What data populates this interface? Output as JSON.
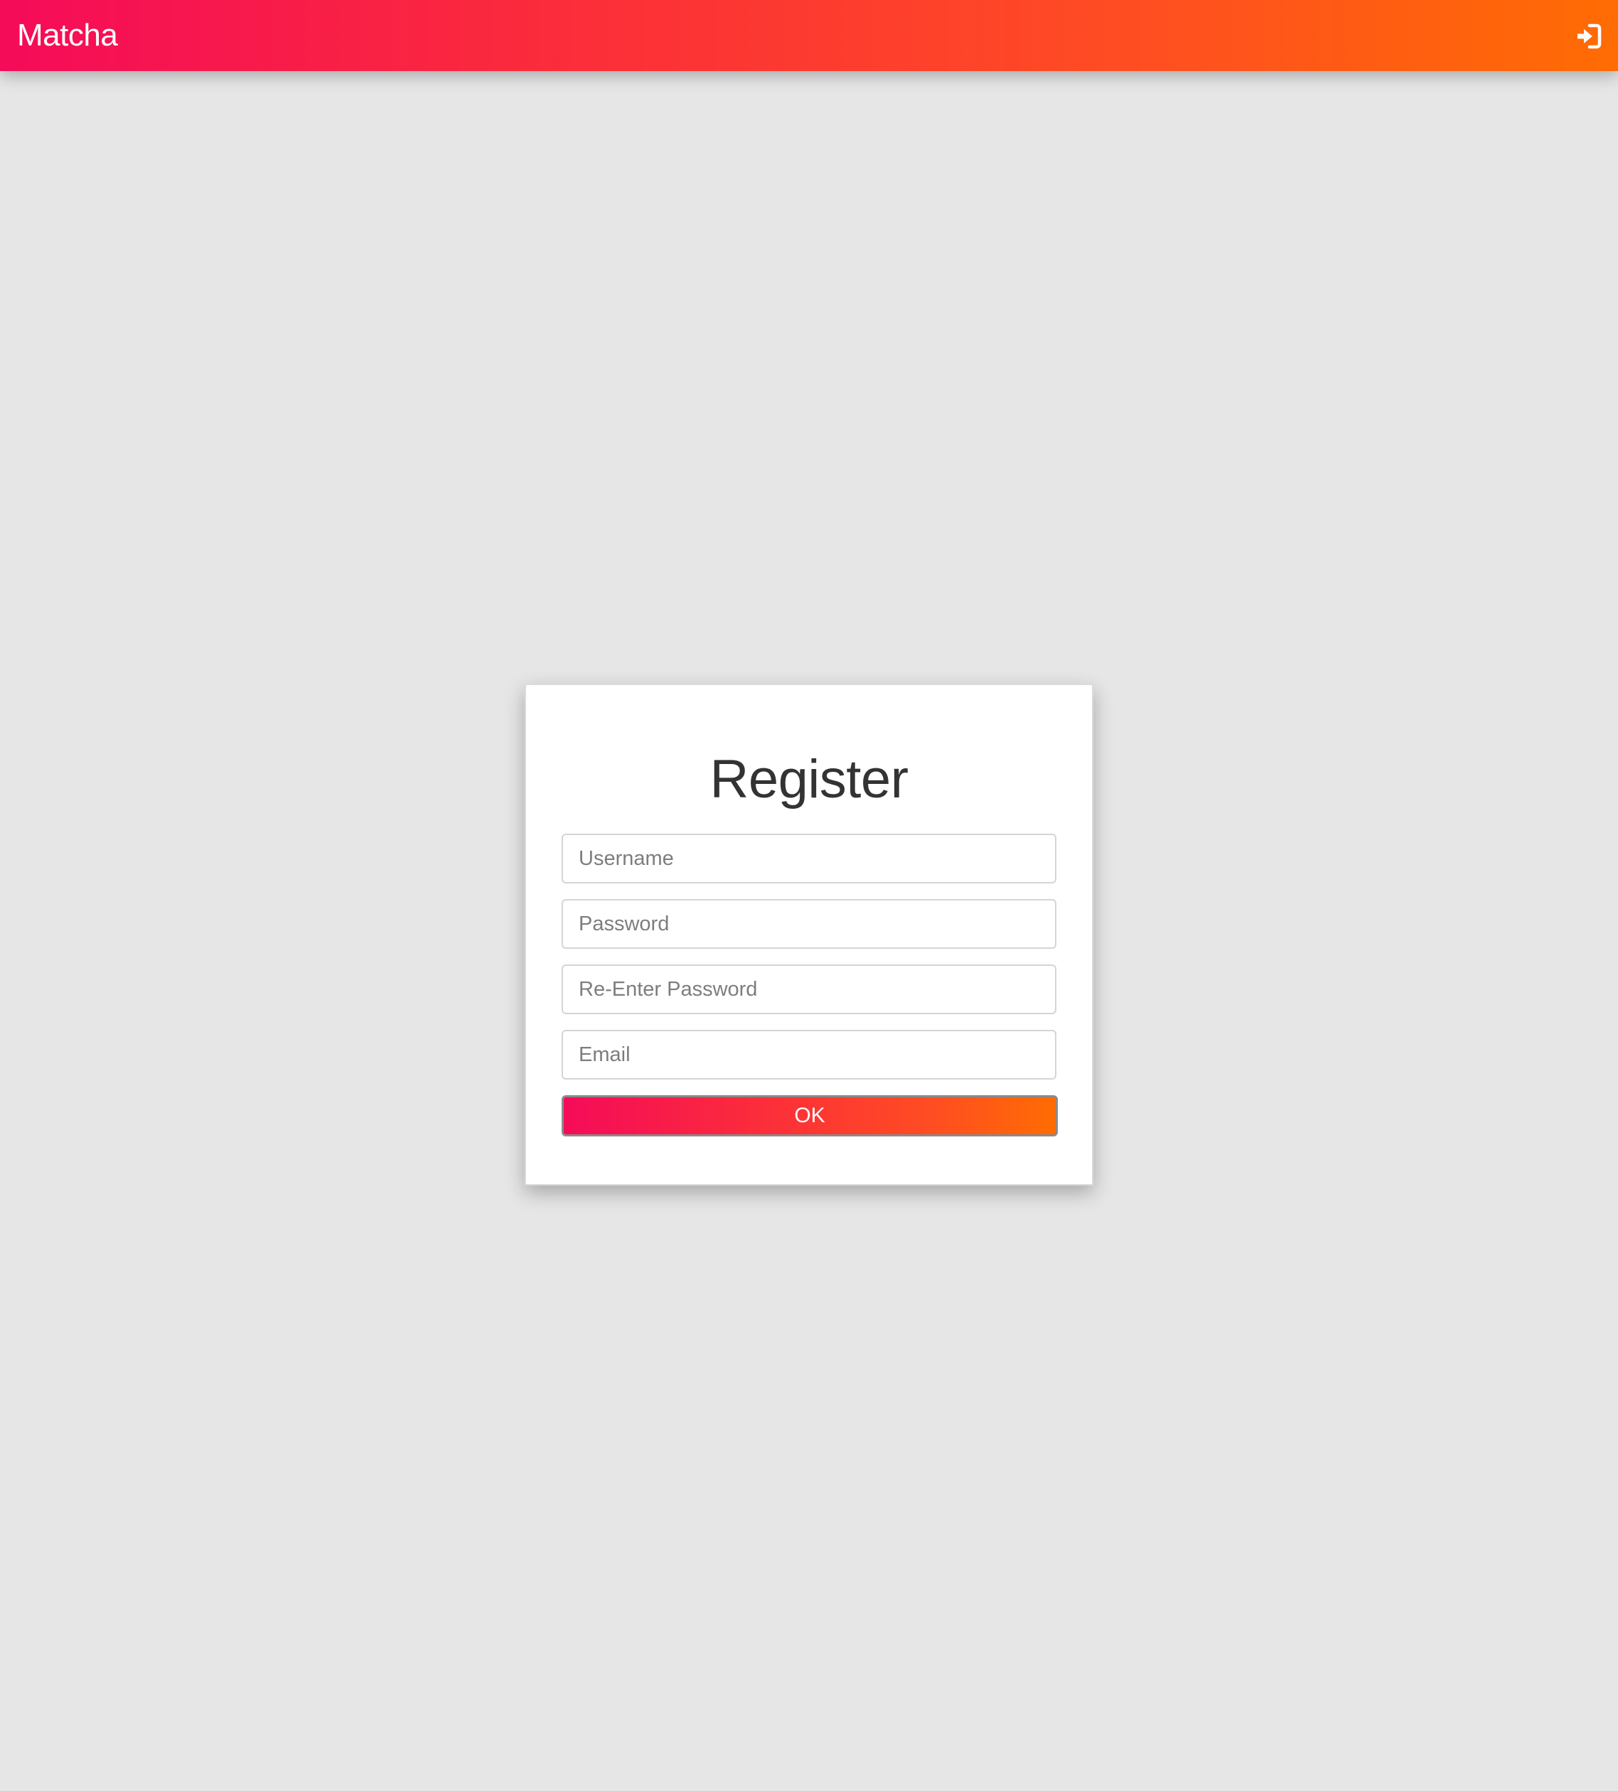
{
  "navbar": {
    "brand": "Matcha",
    "login_icon": "sign-in-icon",
    "gradient_start": "#f50b59",
    "gradient_end": "#ff6c03"
  },
  "register": {
    "title": "Register",
    "fields": {
      "username": {
        "placeholder": "Username",
        "value": ""
      },
      "password": {
        "placeholder": "Password",
        "value": ""
      },
      "password_confirm": {
        "placeholder": "Re-Enter Password",
        "value": ""
      },
      "email": {
        "placeholder": "Email",
        "value": ""
      }
    },
    "submit_label": "OK"
  },
  "colors": {
    "background": "#e6e6e6",
    "card": "#ffffff",
    "title_text": "#333333"
  }
}
